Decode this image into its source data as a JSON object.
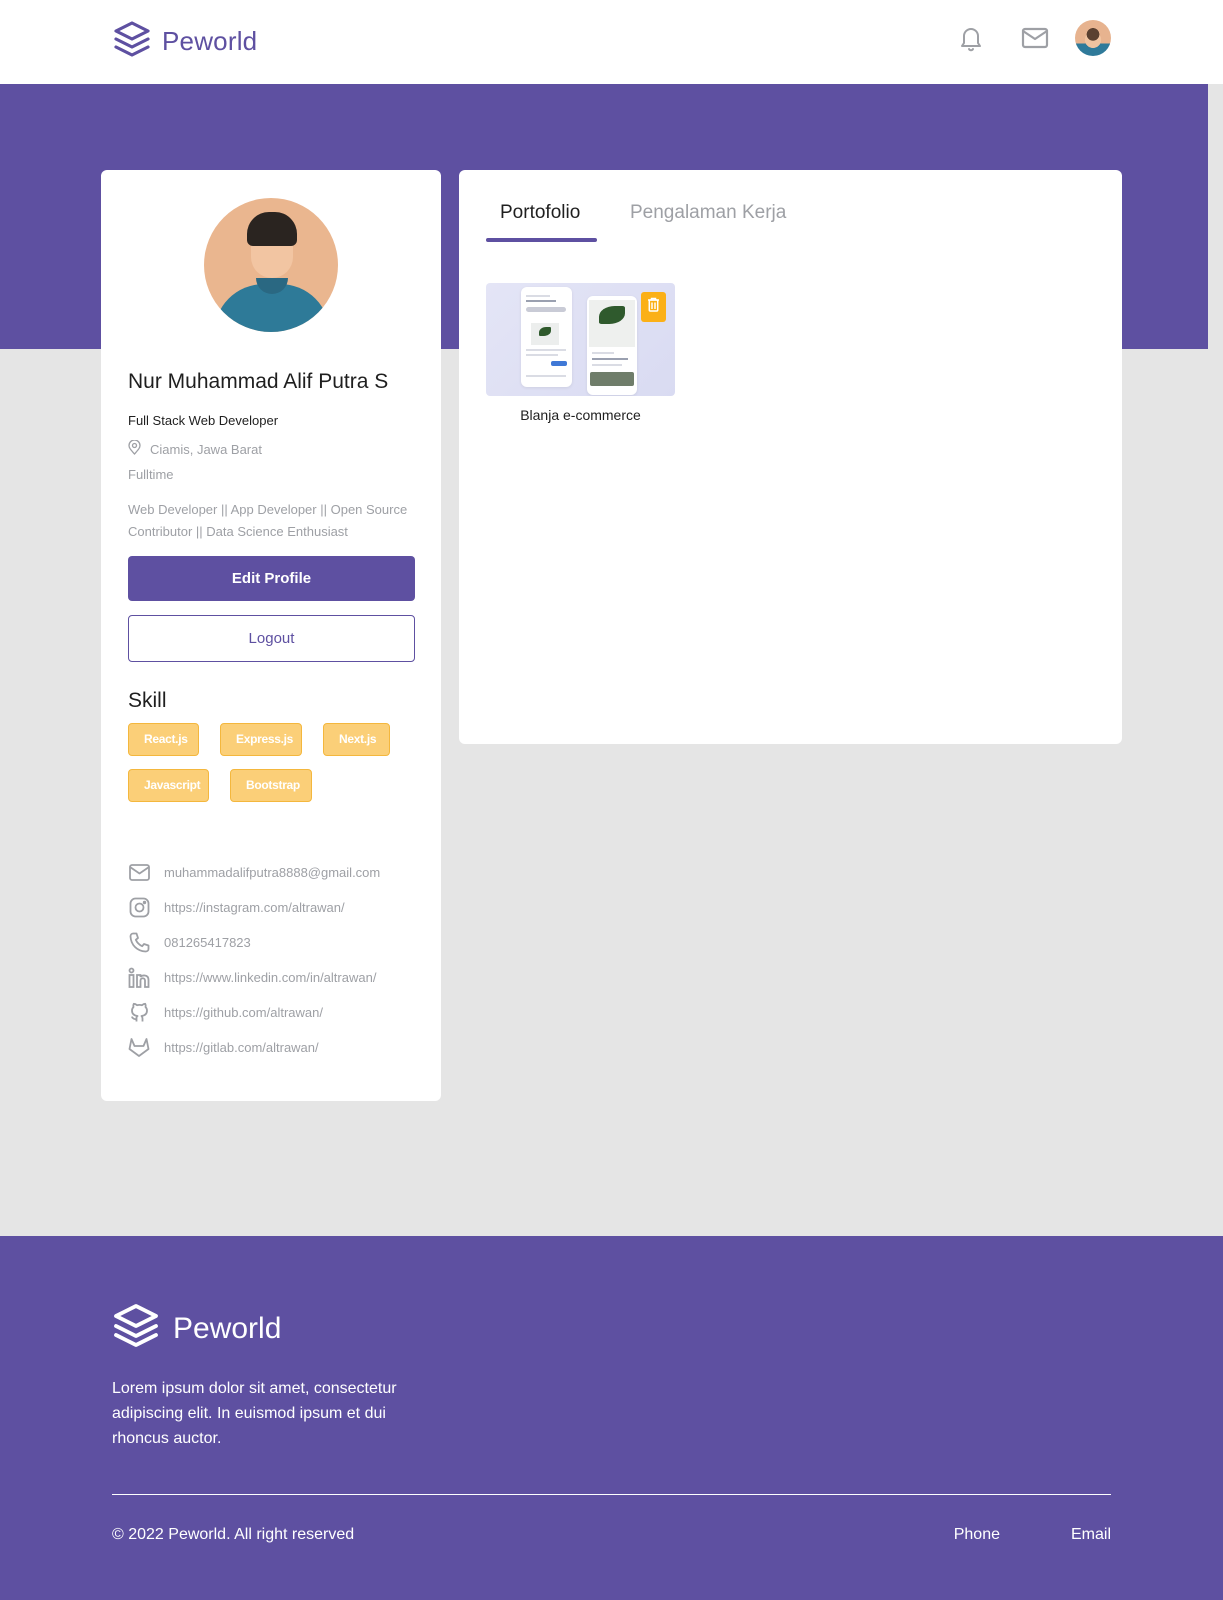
{
  "brand": {
    "name": "Peworld",
    "color": "#5e50a1"
  },
  "navbar": {
    "icons": [
      "bell-icon",
      "mail-icon",
      "user-avatar"
    ]
  },
  "profile": {
    "name": "Nur Muhammad Alif Putra S",
    "title": "Full Stack Web Developer",
    "location": "Ciamis, Jawa Barat",
    "job_type": "Fulltime",
    "bio": "Web Developer || App Developer || Open Source Contributor || Data Science Enthusiast",
    "edit_button": "Edit Profile",
    "logout_button": "Logout",
    "skill_heading": "Skill",
    "skills": [
      "React.js",
      "Express.js",
      "Next.js",
      "Javascript",
      "Bootstrap"
    ],
    "contacts": [
      {
        "icon": "mail-icon",
        "text": "muhammadalifputra8888@gmail.com"
      },
      {
        "icon": "instagram-icon",
        "text": "https://instagram.com/altrawan/"
      },
      {
        "icon": "phone-icon",
        "text": "081265417823"
      },
      {
        "icon": "linkedin-icon",
        "text": "https://www.linkedin.com/in/altrawan/"
      },
      {
        "icon": "github-icon",
        "text": "https://github.com/altrawan/"
      },
      {
        "icon": "gitlab-icon",
        "text": "https://gitlab.com/altrawan/"
      }
    ]
  },
  "tabs": [
    {
      "label": "Portofolio",
      "active": true
    },
    {
      "label": "Pengalaman Kerja",
      "active": false
    }
  ],
  "portfolio": [
    {
      "title": "Blanja e-commerce"
    }
  ],
  "footer": {
    "brand": "Peworld",
    "description": "Lorem ipsum dolor sit amet, consectetur adipiscing elit. In euismod ipsum et dui rhoncus auctor.",
    "copyright": "© 2022 Peworld. All right reserved",
    "links": [
      "Phone",
      "Email"
    ]
  },
  "colors": {
    "primary": "#5e50a1",
    "skill_bg": "#fbcf78",
    "skill_border": "#f4b73d",
    "trash": "#fbb017",
    "muted_text": "#9ea0a5",
    "page_bg": "#e5e5e5"
  }
}
